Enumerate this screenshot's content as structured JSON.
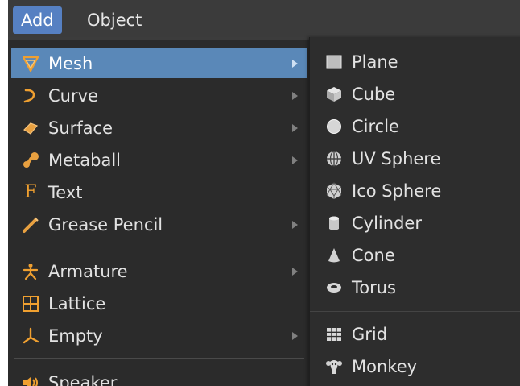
{
  "menubar": {
    "items": [
      {
        "label": "Add"
      },
      {
        "label": "Object"
      }
    ]
  },
  "add_menu": {
    "items": [
      {
        "label": "Mesh",
        "icon": "mesh-icon",
        "submenu": true,
        "active": true
      },
      {
        "label": "Curve",
        "icon": "curve-icon",
        "submenu": true
      },
      {
        "label": "Surface",
        "icon": "surface-icon",
        "submenu": true
      },
      {
        "label": "Metaball",
        "icon": "metaball-icon",
        "submenu": true
      },
      {
        "label": "Text",
        "icon": "text-icon",
        "icon_glyph": "F",
        "submenu": false
      },
      {
        "label": "Grease Pencil",
        "icon": "grease-pencil-icon",
        "submenu": true
      },
      {
        "label": "Armature",
        "icon": "armature-icon",
        "submenu": true
      },
      {
        "label": "Lattice",
        "icon": "lattice-icon",
        "submenu": false
      },
      {
        "label": "Empty",
        "icon": "empty-icon",
        "submenu": true
      },
      {
        "label": "Speaker",
        "icon": "speaker-icon",
        "submenu": false
      }
    ]
  },
  "mesh_submenu": {
    "items": [
      {
        "label": "Plane",
        "icon": "plane-icon"
      },
      {
        "label": "Cube",
        "icon": "cube-icon"
      },
      {
        "label": "Circle",
        "icon": "circle-icon"
      },
      {
        "label": "UV Sphere",
        "icon": "uv-sphere-icon"
      },
      {
        "label": "Ico Sphere",
        "icon": "ico-sphere-icon"
      },
      {
        "label": "Cylinder",
        "icon": "cylinder-icon"
      },
      {
        "label": "Cone",
        "icon": "cone-icon"
      },
      {
        "label": "Torus",
        "icon": "torus-icon"
      },
      {
        "label": "Grid",
        "icon": "grid-icon"
      },
      {
        "label": "Monkey",
        "icon": "monkey-icon"
      }
    ]
  },
  "colors": {
    "menubar_active": "#5680c2",
    "row_highlight": "#5a88b8",
    "menu_bg": "#2b2b2b",
    "icon_orange": "#f0a030"
  }
}
